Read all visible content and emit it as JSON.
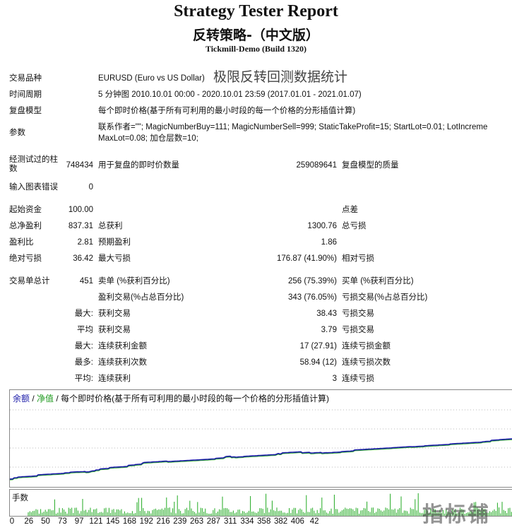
{
  "header": {
    "title": "Strategy Tester Report",
    "subtitle": "反转策略-（中文版）",
    "server": "Tickmill-Demo (Build 1320)"
  },
  "info": {
    "symbol_label": "交易品种",
    "symbol_value": "EURUSD (Euro vs US Dollar)",
    "overlay_text": "极限反转回测数据统计",
    "period_label": "时间周期",
    "period_value": "5 分钟图 2010.10.01 00:00 - 2020.10.01 23:59 (2017.01.01 - 2021.01.07)",
    "model_label": "复盘模型",
    "model_value": "每个即时价格(基于所有可利用的最小时段的每一个价格的分形插值计算)",
    "params_label": "参数",
    "params_line1": "联系作者=\"\"; MagicNumberBuy=111; MagicNumberSell=999; StaticTakeProfit=15; StartLot=0.01; LotIncreme",
    "params_line2": "MaxLot=0.08; 加仓层数=10;"
  },
  "bars": {
    "bars_label": "经测试过的柱数",
    "bars_value": "748434",
    "ticks_label": "用于复盘的即时价数量",
    "ticks_value": "259089641",
    "quality_label": "复盘模型的质量",
    "errors_label": "输入图表错误",
    "errors_value": "0"
  },
  "stats": {
    "initial_deposit_label": "起始资金",
    "initial_deposit_value": "100.00",
    "spread_label": "点差",
    "net_profit_label": "总净盈利",
    "net_profit_value": "837.31",
    "gross_profit_label": "总获利",
    "gross_profit_value": "1300.76",
    "gross_loss_label": "总亏损",
    "profit_factor_label": "盈利比",
    "profit_factor_value": "2.81",
    "expected_payoff_label": "预期盈利",
    "expected_payoff_value": "1.86",
    "abs_drawdown_label": "绝对亏损",
    "abs_drawdown_value": "36.42",
    "max_drawdown_label": "最大亏损",
    "max_drawdown_value": "176.87 (41.90%)",
    "rel_drawdown_label": "相对亏损",
    "total_trades_label": "交易单总计",
    "total_trades_value": "451",
    "short_label": "卖单 (%获利百分比)",
    "short_value": "256 (75.39%)",
    "long_label": "买单 (%获利百分比)",
    "profit_trades_label": "盈利交易(%占总百分比)",
    "profit_trades_value": "343 (76.05%)",
    "loss_trades_label": "亏损交易(%占总百分比)",
    "largest_label": "最大:",
    "largest_profit_label": "获利交易",
    "largest_profit_value": "38.43",
    "largest_loss_label": "亏损交易",
    "average_label": "平均",
    "avg_profit_label": "获利交易",
    "avg_profit_value": "3.79",
    "avg_loss_label": "亏损交易",
    "max_label": "最大:",
    "cons_wins_money_label": "连续获利金额",
    "cons_wins_money_value": "17 (27.91)",
    "cons_losses_money_label": "连续亏损金额",
    "maximal_label": "最多:",
    "cons_profit_count_label": "连续获利次数",
    "cons_profit_count_value": "58.94 (12)",
    "cons_loss_count_label": "连续亏损次数",
    "avg2_label": "平均:",
    "avg_cons_wins_label": "连续获利",
    "avg_cons_wins_value": "3",
    "avg_cons_losses_label": "连续亏损"
  },
  "graph": {
    "legend_balance": "余额",
    "legend_sep1": " / ",
    "legend_equity": "净值",
    "legend_sep2": " / ",
    "legend_model": "每个即时价格(基于所有可利用的最小时段的每一个价格的分形插值计算)",
    "balance_color": "#1a1aa8",
    "equity_color": "#2aa52a",
    "volume_label": "手数",
    "volume_color": "#22aa22",
    "x_ticks": [
      "0",
      "26",
      "50",
      "73",
      "97",
      "121",
      "145",
      "168",
      "192",
      "216",
      "239",
      "263",
      "287",
      "311",
      "334",
      "358",
      "382",
      "406",
      "42"
    ]
  },
  "watermark": "指标铺"
}
